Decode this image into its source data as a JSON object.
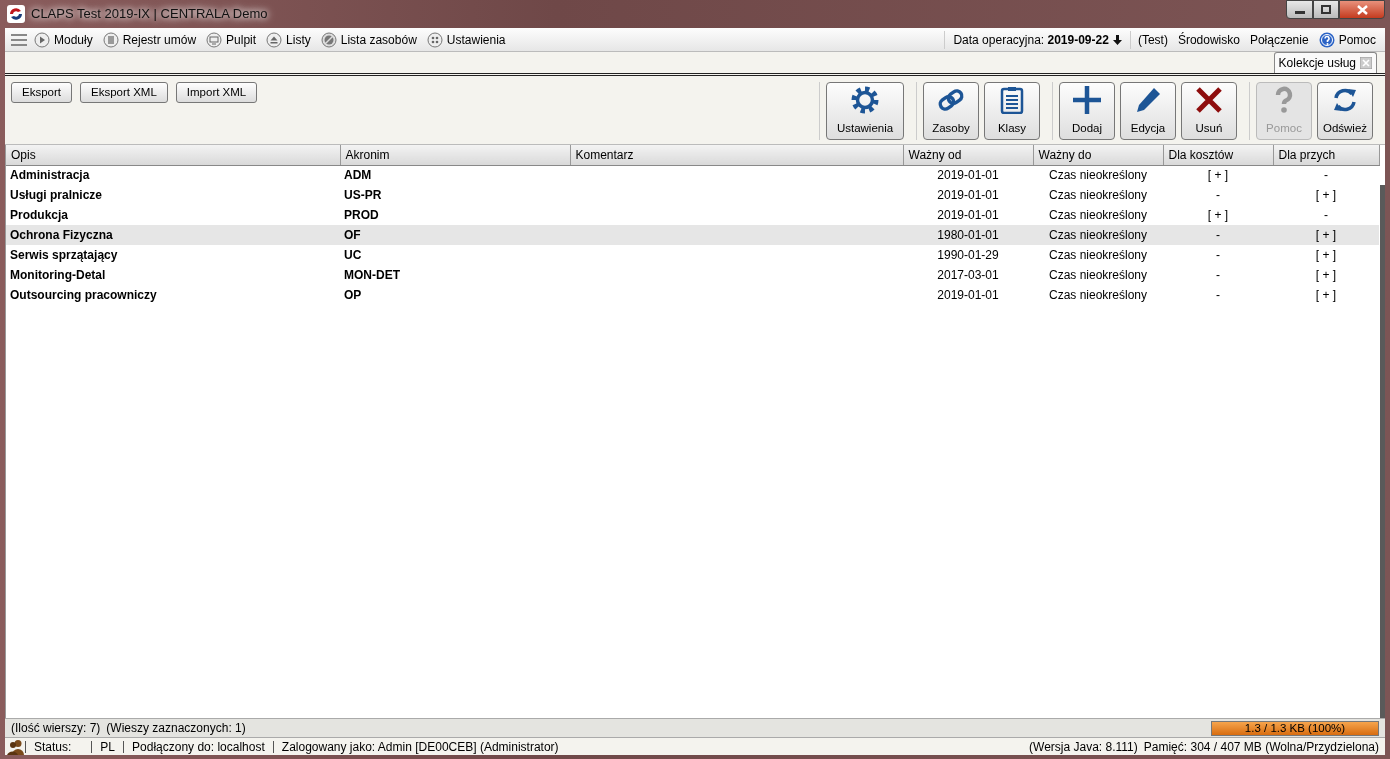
{
  "window": {
    "title": "CLAPS Test 2019-IX | CENTRALA Demo"
  },
  "menu": {
    "items": [
      "Moduły",
      "Rejestr umów",
      "Pulpit",
      "Listy",
      "Lista zasobów",
      "Ustawienia"
    ],
    "operating_date": "Data operacyjna: **2019-09-22**",
    "right_items": [
      "(Test)",
      "Środowisko",
      "Połączenie"
    ],
    "help": "Pomoc"
  },
  "tabs": [
    {
      "label": "Kolekcje usług",
      "selected": true
    }
  ],
  "small_buttons": [
    "Eksport",
    "Eksport XML",
    "Import XML"
  ],
  "toolbar_groups": [
    [
      {
        "label": "Ustawienia",
        "disabled": false
      }
    ],
    [
      {
        "label": "Zasoby",
        "disabled": false
      },
      {
        "label": "Klasy",
        "disabled": false
      }
    ],
    [
      {
        "label": "Dodaj",
        "disabled": false
      },
      {
        "label": "Edycja",
        "disabled": false
      },
      {
        "label": "Usuń",
        "disabled": false
      }
    ],
    [
      {
        "label": "Pomoc",
        "disabled": true
      },
      {
        "label": "Odśwież",
        "disabled": false
      }
    ]
  ],
  "table": {
    "columns": [
      "Opis",
      "Akronim",
      "Komentarz",
      "Ważny od",
      "Ważny do",
      "Dla kosztów",
      "Dla przych"
    ],
    "rows": [
      {
        "cells": [
          "Administracja",
          "ADM",
          "",
          "2019-01-01",
          "Czas nieokreślony",
          "[ + ]",
          "-"
        ],
        "selected": false
      },
      {
        "cells": [
          "Usługi pralnicze",
          "US-PR",
          "",
          "2019-01-01",
          "Czas nieokreślony",
          "-",
          "[ + ]"
        ],
        "selected": false
      },
      {
        "cells": [
          "Produkcja",
          "PROD",
          "",
          "2019-01-01",
          "Czas nieokreślony",
          "[ + ]",
          "-"
        ],
        "selected": false
      },
      {
        "cells": [
          "Ochrona Fizyczna",
          "OF",
          "",
          "1980-01-01",
          "Czas nieokreślony",
          "-",
          "[ + ]"
        ],
        "selected": true
      },
      {
        "cells": [
          "Serwis sprzątający",
          "UC",
          "",
          "1990-01-29",
          "Czas nieokreślony",
          "-",
          "[ + ]"
        ],
        "selected": false
      },
      {
        "cells": [
          "Monitoring-Detal",
          "MON-DET",
          "",
          "2017-03-01",
          "Czas nieokreślony",
          "-",
          "[ + ]"
        ],
        "selected": false
      },
      {
        "cells": [
          "Outsourcing pracowniczy",
          "OP",
          "",
          "2019-01-01",
          "Czas nieokreślony",
          "-",
          "[ + ]"
        ],
        "selected": false
      }
    ]
  },
  "row_info": [
    "(Ilość wierszy: 7)",
    "(Wieszy zaznaczonych: 1)"
  ],
  "memory_bar": {
    "level": 1.0,
    "reading": "1.3 / 1.3 KB (100%)"
  },
  "status_bar": {
    "left": [
      "Status:",
      "PL",
      "Podłączony do: localhost",
      "Zalogowany jako: Admin [DE00CEB] (Administrator)"
    ],
    "right": [
      "(Wersja Java: 8.111)",
      "Pamięć: 304 / 407 MB (Wolna/Przydzielona)"
    ]
  }
}
